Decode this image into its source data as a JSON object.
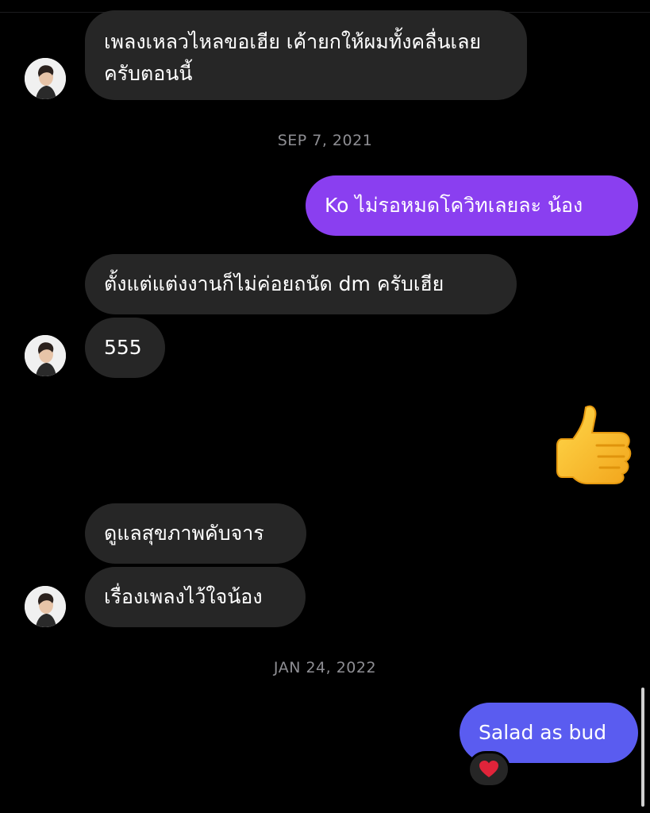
{
  "conversation": {
    "messages": [
      {
        "direction": "in",
        "text": "เพลงเหลวไหลขอเฮีย เค้ายกให้ผมทั้งคลื่นเลยครับตอนนี้"
      },
      {
        "direction": "out",
        "text": "Ko ไม่รอหมดโควิทเลยละ น้อง"
      },
      {
        "direction": "in",
        "text": "ตั้งแต่แต่งงานก็ไม่ค่อยถนัด dm ครับเฮีย"
      },
      {
        "direction": "in",
        "text": "555"
      },
      {
        "direction": "out",
        "type": "emoji",
        "icon": "thumbs-up-icon"
      },
      {
        "direction": "in",
        "text": "ดูแลสุขภาพคับจาร"
      },
      {
        "direction": "in",
        "text": "เรื่องเพลงไว้ใจน้อง"
      },
      {
        "direction": "out",
        "text": "Salad as bud",
        "reaction": "heart-icon"
      }
    ],
    "date_separators": [
      "SEP 7, 2021",
      "JAN 24, 2022"
    ]
  },
  "colors": {
    "background": "#000000",
    "incoming_bubble": "#262626",
    "outgoing_bubble_purple": "#8a3ff0",
    "outgoing_bubble_blue": "#5a5cf0",
    "date_text": "#8e8e93",
    "heart": "#e0243a"
  }
}
